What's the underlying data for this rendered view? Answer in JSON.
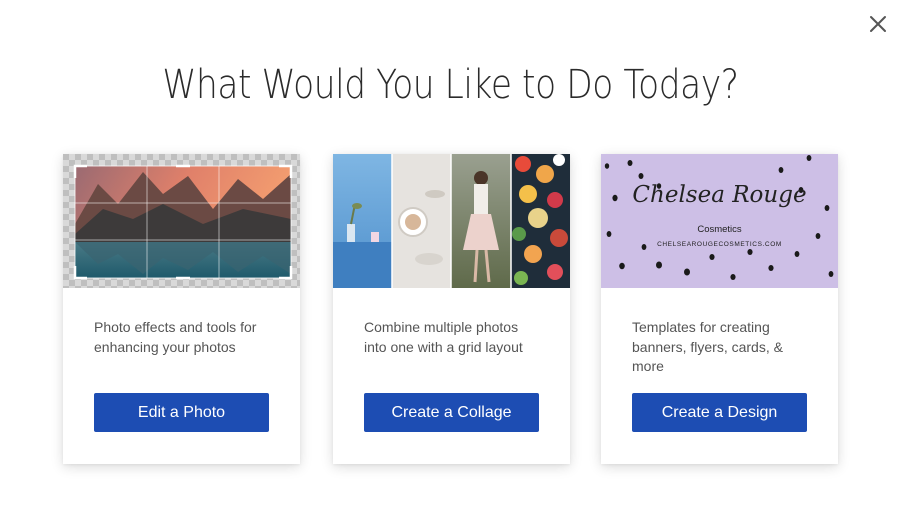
{
  "dialog": {
    "title": "What Would You Like to Do Today?",
    "close_icon": "close-icon"
  },
  "cards": [
    {
      "image": "photo-editor-crop-preview",
      "description": "Photo effects and tools for enhancing your photos",
      "button_label": "Edit a Photo"
    },
    {
      "image": "collage-preview",
      "description": "Combine multiple photos into one with a grid layout",
      "button_label": "Create a Collage"
    },
    {
      "image": "design-template-preview",
      "template_title": "Chelsea Rouge",
      "template_subtitle": "Cosmetics",
      "template_url": "CHELSEAROUGECOSMETICS.COM",
      "description": "Templates for creating banners, flyers, cards, & more",
      "button_label": "Create a Design"
    }
  ],
  "colors": {
    "button": "#1d4db3",
    "template_bg": "#cdbfe6"
  }
}
